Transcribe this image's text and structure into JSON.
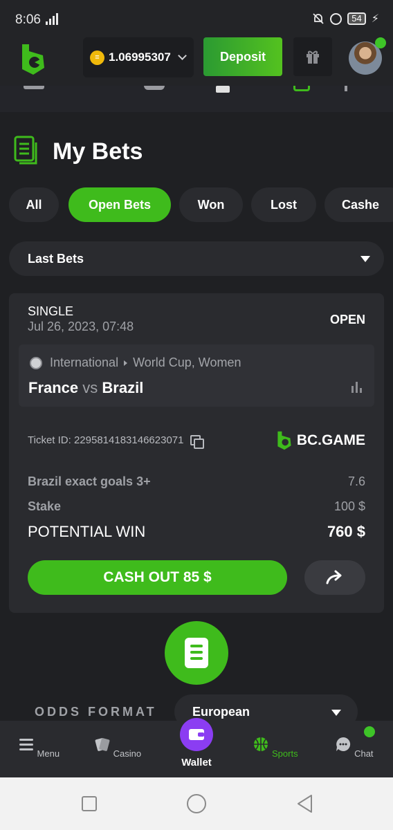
{
  "status_bar": {
    "time": "8:06",
    "battery": "54"
  },
  "header": {
    "balance": "1.06995307",
    "deposit_label": "Deposit"
  },
  "page": {
    "title": "My Bets"
  },
  "filters": [
    {
      "label": "All",
      "active": false
    },
    {
      "label": "Open Bets",
      "active": true
    },
    {
      "label": "Won",
      "active": false
    },
    {
      "label": "Lost",
      "active": false
    },
    {
      "label": "Cashe",
      "active": false
    }
  ],
  "last_bets": {
    "label": "Last Bets"
  },
  "bet": {
    "type": "SINGLE",
    "date": "Jul 26, 2023, 07:48",
    "status": "OPEN",
    "league_country": "International",
    "league_name": "World Cup, Women",
    "home": "France",
    "vs": "vs",
    "away": "Brazil",
    "ticket_label": "Ticket ID:",
    "ticket_id": "2295814183146623071",
    "brand": "BC.GAME",
    "selection": "Brazil exact goals 3+",
    "odds": "7.6",
    "stake_label": "Stake",
    "stake": "100 $",
    "potential_label": "POTENTIAL WIN",
    "potential": "760 $",
    "cashout_label": "CASH OUT 85 $"
  },
  "odds_format": {
    "label": "ODDS FORMAT",
    "value": "European"
  },
  "bottom_nav": {
    "menu": "Menu",
    "casino": "Casino",
    "wallet": "Wallet",
    "sports": "Sports",
    "chat": "Chat"
  },
  "colors": {
    "accent_green": "#3fbb1c",
    "background": "#1f2023",
    "card": "#2a2b2f",
    "wallet_purple": "#8b3df2"
  }
}
